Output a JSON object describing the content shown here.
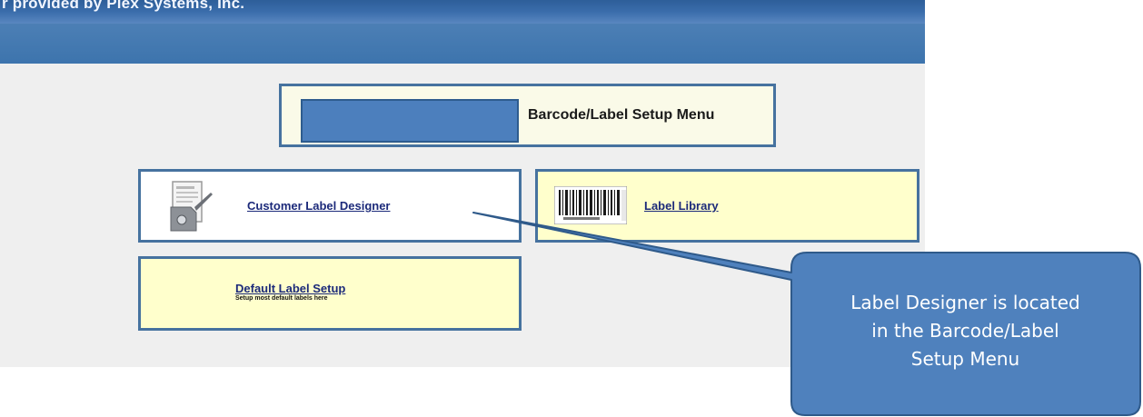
{
  "banner": {
    "text": "r provided by Plex Systems, Inc."
  },
  "menu": {
    "title": "Barcode/Label Setup Menu"
  },
  "tiles": {
    "customer_label_designer": {
      "label": "Customer Label Designer"
    },
    "label_library": {
      "label": "Label Library"
    },
    "default_label_setup": {
      "label": "Default Label Setup",
      "subtitle": "Setup most default labels here"
    }
  },
  "callout": {
    "lines": [
      "Label Designer is located",
      "in the Barcode/Label",
      "Setup Menu"
    ]
  },
  "colors": {
    "accent": "#4f81bd",
    "tile_border": "#46729f",
    "tile_fill": "#ffffcc",
    "link": "#1c2a7a"
  }
}
